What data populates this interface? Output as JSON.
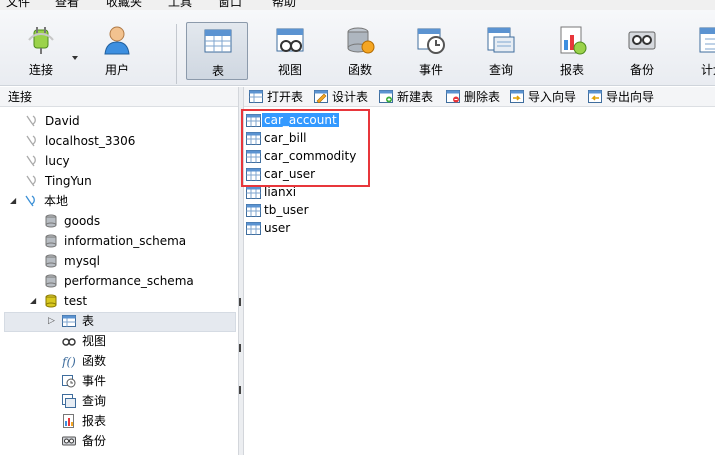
{
  "menu": [
    "文件",
    "查看",
    "收藏夹",
    "工具",
    "窗口",
    "帮助"
  ],
  "toolbar": {
    "connect_label": "连接",
    "user_label": "用户",
    "table_label": "表",
    "view_label": "视图",
    "function_label": "函数",
    "event_label": "事件",
    "query_label": "查询",
    "report_label": "报表",
    "backup_label": "备份",
    "schedule_label": "计划"
  },
  "left_header": "连接",
  "object_toolbar": {
    "open_table": "打开表",
    "design_table": "设计表",
    "new_table": "新建表",
    "delete_table": "删除表",
    "import_wizard": "导入向导",
    "export_wizard": "导出向导"
  },
  "tree": {
    "connections": [
      "David",
      "localhost_3306",
      "lucy",
      "TingYun"
    ],
    "local": "本地",
    "databases": [
      "goods",
      "information_schema",
      "mysql",
      "performance_schema"
    ],
    "test_db": "test",
    "test_children": [
      "表",
      "视图",
      "函数",
      "事件",
      "查询",
      "报表",
      "备份"
    ]
  },
  "tables": [
    "car_account",
    "car_bill",
    "car_commodity",
    "car_user",
    "lianxi",
    "tb_user",
    "user"
  ],
  "selected_table": "car_account",
  "colors": {
    "selection": "#3399ff",
    "highlight_box": "#e8363b"
  }
}
